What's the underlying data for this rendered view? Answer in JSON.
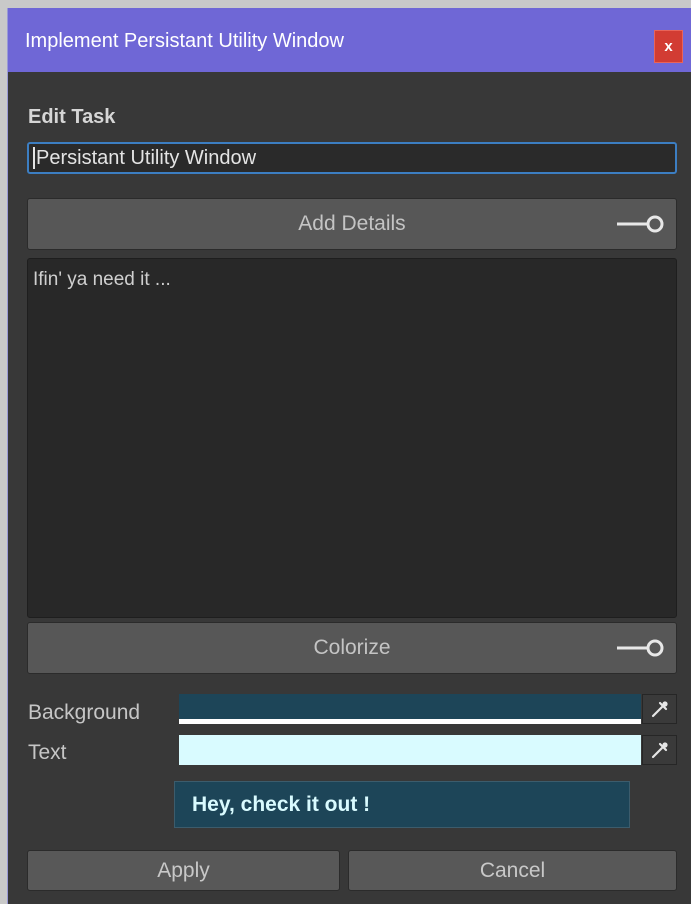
{
  "window": {
    "title": "Implement Persistant Utility Window",
    "close_label": "x"
  },
  "edit": {
    "section_label": "Edit Task",
    "task_name_value": "Persistant Utility Window"
  },
  "details": {
    "toggle_label": "Add Details",
    "toggle_on": true,
    "text": "Ifin' ya need it ..."
  },
  "colorize": {
    "toggle_label": "Colorize",
    "toggle_on": true,
    "background_label": "Background",
    "background_color": "#1d4558",
    "text_label": "Text",
    "text_color": "#d9fbff",
    "picker_icon": "eyedropper-icon",
    "preview_text": "Hey, check it out !"
  },
  "actions": {
    "apply_label": "Apply",
    "cancel_label": "Cancel"
  },
  "colors": {
    "titlebar": "#6f67d6",
    "close_button": "#d23c33",
    "input_focus_border": "#3c7ec2",
    "panel_bg": "#383838"
  }
}
